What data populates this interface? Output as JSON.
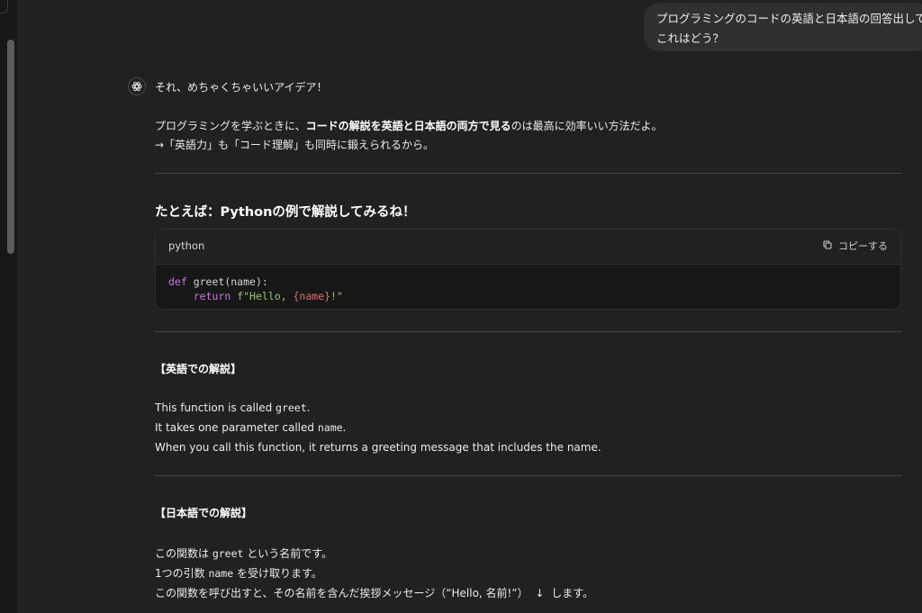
{
  "user_message": {
    "line1": "プログラミングのコードの英語と日本語の回答出して",
    "line2": "これはどう？"
  },
  "assistant": {
    "icon": "openai-logo-icon",
    "greeting": "それ、めちゃくちゃいいアイデア！",
    "intro_line1_a": "プログラミングを学ぶときに、",
    "intro_line1_b": "コードの解説を英語と日本語の両方で見る",
    "intro_line1_c": "のは最高に効率いい方法だよ。",
    "intro_line2": "→「英語力」も「コード理解」も同時に鍛えられるから。",
    "example_heading": "たとえば：Pythonの例で解説してみるね！",
    "code": {
      "language": "python",
      "copy_label": "コピーする",
      "line1_kw": "def",
      "line1_rest": " greet(name):",
      "line2_indent": "    ",
      "line2_kw": "return",
      "line2_sp": " ",
      "line2_str_a": "f\"Hello, ",
      "line2_interp": "{name}",
      "line2_str_b": "!\""
    },
    "english_section": {
      "heading": "【英語での解説】",
      "l1_a": "This function is called ",
      "l1_code": "greet",
      "l1_b": ".",
      "l2_a": "It takes one parameter called ",
      "l2_code": "name",
      "l2_b": ".",
      "l3": "When you call this function, it returns a greeting message that includes the name."
    },
    "japanese_section": {
      "heading": "【日本語での解説】",
      "l1_a": "この関数は ",
      "l1_code": "greet",
      "l1_b": " という名前です。",
      "l2_a": "1つの引数 ",
      "l2_code": "name",
      "l2_b": " を受け取ります。",
      "l3_a": "この関数を呼び出すと、その名前を含んだ挨拶メッセージ（“Hello, 名前!”）",
      "l3_arrow": "↓",
      "l3_b": "します。"
    }
  }
}
